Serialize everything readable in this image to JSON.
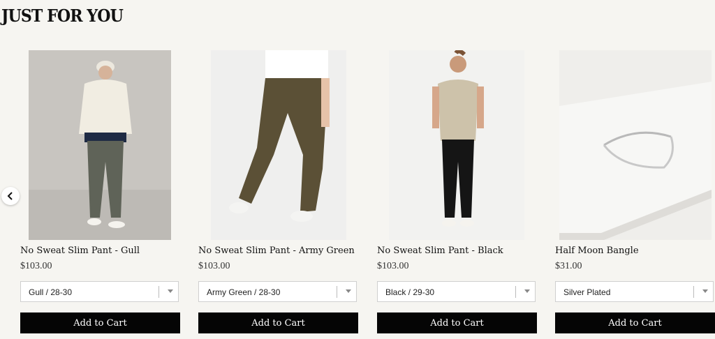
{
  "section": {
    "title": "JUST FOR YOU"
  },
  "carousel": {
    "prev_icon": "chevron-left-icon"
  },
  "products": [
    {
      "name": "No Sweat Slim Pant - Gull",
      "price": "$103.00",
      "variant": "Gull / 28-30",
      "cta": "Add to Cart"
    },
    {
      "name": "No Sweat Slim Pant - Army Green",
      "price": "$103.00",
      "variant": "Army Green / 28-30",
      "cta": "Add to Cart"
    },
    {
      "name": "No Sweat Slim Pant - Black",
      "price": "$103.00",
      "variant": "Black / 29-30",
      "cta": "Add to Cart"
    },
    {
      "name": "Half Moon Bangle",
      "price": "$31.00",
      "variant": "Silver Plated",
      "cta": "Add to Cart"
    }
  ],
  "colors": {
    "page_bg": "#f6f5f1",
    "button_bg": "#050505",
    "button_text": "#ffffff"
  }
}
